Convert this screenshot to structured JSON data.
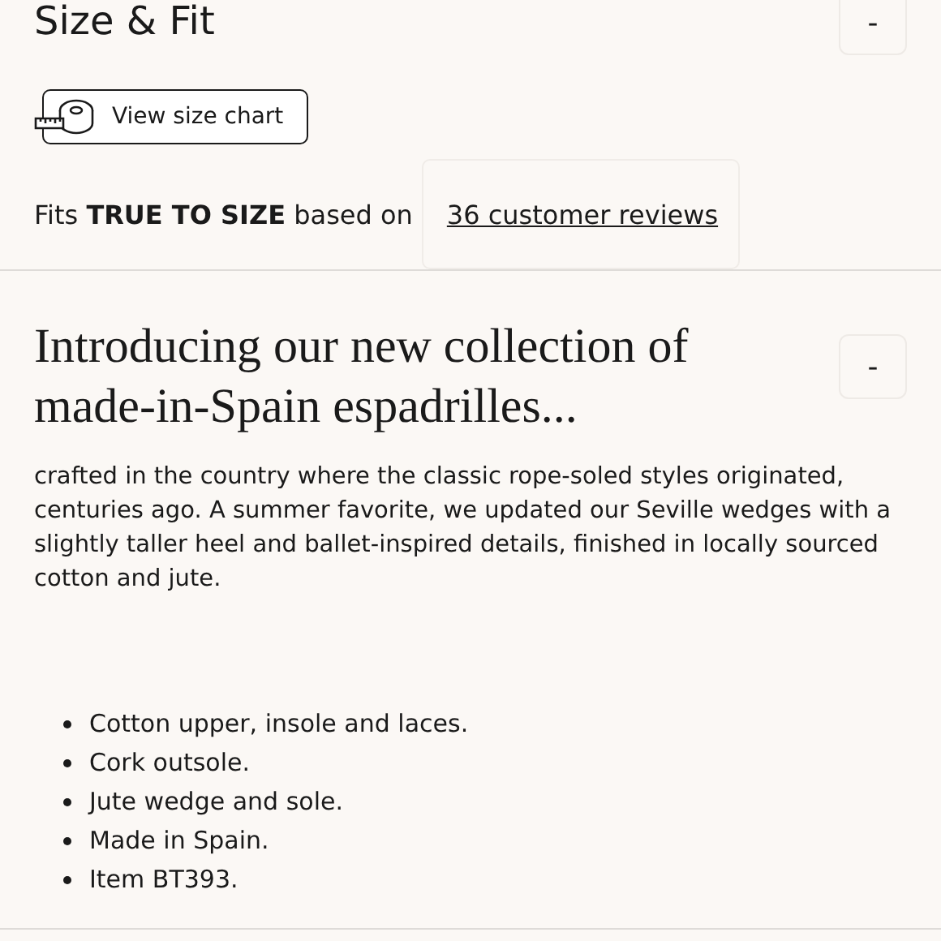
{
  "size_fit": {
    "title": "Size & Fit",
    "toggle": "-",
    "expanded": true,
    "size_chart_button": "View size chart",
    "fit_text": "Fits **TRUE TO SIZE** based on",
    "reviews_link": "36 customer reviews"
  },
  "description": {
    "title": "Introducing our new collection of made-in-Spain espadrilles...",
    "toggle": "-",
    "expanded": true,
    "paragraph": "crafted in the country where the classic rope-soled styles originated, centuries ago. A summer favorite, we updated our Seville wedges with a slightly taller heel and ballet-inspired details, finished in locally sourced cotton and jute.",
    "features": [
      "Cotton upper, insole and laces.",
      "Cork outsole.",
      "Jute wedge and sole.",
      "Made in Spain.",
      "Item BT393."
    ]
  }
}
